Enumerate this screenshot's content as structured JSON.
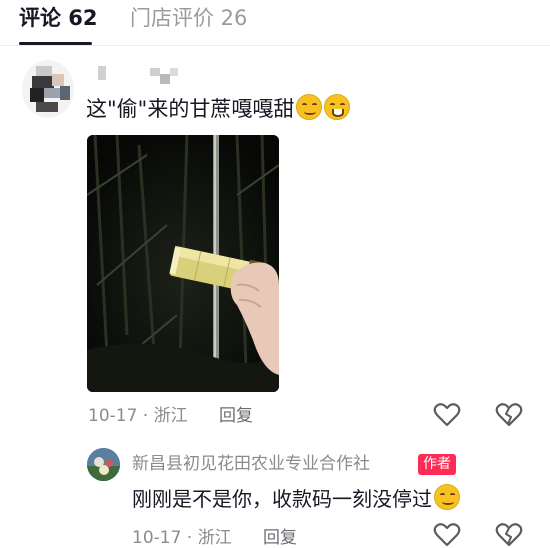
{
  "tabs": {
    "comments_label": "评论 62",
    "store_reviews_label": "门店评价 26"
  },
  "comment": {
    "text": "这\"偷\"来的甘蔗嘎嘎甜",
    "emojis": [
      "smirk-emoji",
      "grin-emoji"
    ],
    "date": "10-17 · 浙江",
    "reply_label": "回复"
  },
  "reply": {
    "author": "新昌县初见花田农业专业合作社",
    "author_badge": "作者",
    "text": "刚刚是不是你，收款码一刻没停过",
    "emojis": [
      "smirk-emoji"
    ],
    "date": "10-17 · 浙江",
    "reply_label": "回复"
  },
  "colors": {
    "accent": "#fe2c55",
    "primary_text": "#161823",
    "secondary_text": "#8a8b91"
  }
}
